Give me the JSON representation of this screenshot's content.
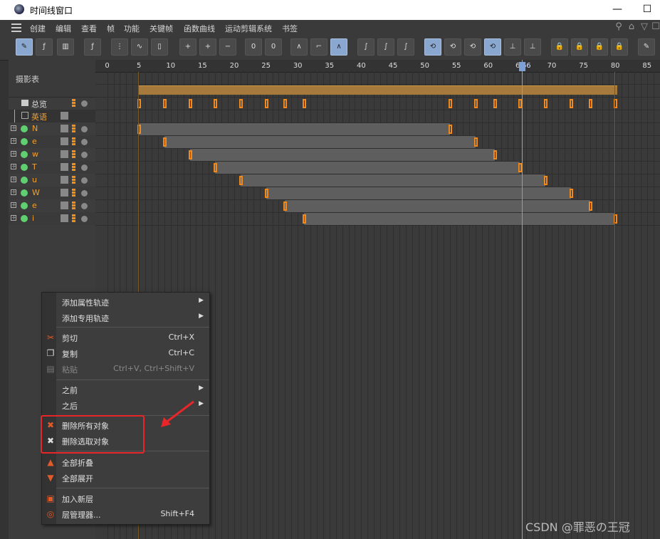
{
  "window": {
    "title": "时间线窗口",
    "minimize": "—",
    "maximize": "☐"
  },
  "menu": {
    "items": [
      "创建",
      "编辑",
      "查看",
      "帧",
      "功能",
      "关键帧",
      "函数曲线",
      "运动剪辑系统",
      "书签"
    ]
  },
  "left_panel": {
    "header": "摄影表",
    "summary_label": "总览",
    "group_label": "英语",
    "tracks": [
      "N",
      "e",
      "w",
      "T",
      "u",
      "W",
      "e",
      "i"
    ]
  },
  "ruler": {
    "labels": [
      "0",
      "5",
      "10",
      "15",
      "20",
      "25",
      "30",
      "35",
      "40",
      "45",
      "50",
      "55",
      "60",
      "65",
      "66",
      "70",
      "75",
      "80",
      "85"
    ]
  },
  "current_frame": 66,
  "colors": {
    "accent": "#f08a1c",
    "track_text": "#f0a030",
    "highlight": "#e8262a",
    "playhead": "#7ea0d8"
  },
  "context_menu": {
    "add_attr_track": "添加属性轨迹",
    "add_special_track": "添加专用轨迹",
    "cut": "剪切",
    "cut_sc": "Ctrl+X",
    "copy": "复制",
    "copy_sc": "Ctrl+C",
    "paste": "粘贴",
    "paste_sc": "Ctrl+V, Ctrl+Shift+V",
    "before": "之前",
    "after": "之后",
    "delete_all": "删除所有对象",
    "delete_selected": "删除选取对象",
    "collapse_all": "全部折叠",
    "expand_all": "全部展开",
    "add_layer": "加入新层",
    "layer_manager": "层管理器...",
    "layer_manager_sc": "Shift+F4"
  },
  "watermark": "CSDN @罪恶の王冠"
}
